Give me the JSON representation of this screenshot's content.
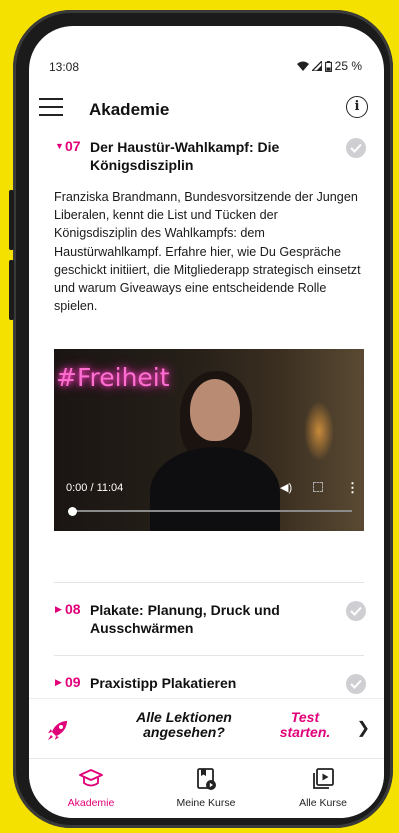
{
  "status": {
    "time": "13:08",
    "battery": "25 %"
  },
  "appbar": {
    "title": "Akademie",
    "menu_icon": "menu-icon",
    "info_icon": "info-icon"
  },
  "lessons": [
    {
      "number": "07",
      "title": "Der Haustür-Wahlkampf: Die Königsdisziplin",
      "expanded": true,
      "completed": true,
      "description": "Franziska Brandmann, Bundesvorsitzende der Jungen Liberalen, kennt die List und Tücken der Königsdisziplin des Wahlkampfs: dem Haustürwahlkampf. Erfahre hier, wie Du Gespräche geschickt initiiert, die Mitgliederapp strategisch einsetzt und warum Giveaways eine entscheidende Rolle spielen."
    },
    {
      "number": "08",
      "title": "Plakate: Planung, Druck und Ausschwärmen",
      "expanded": false,
      "completed": true
    },
    {
      "number": "09",
      "title": "Praxistipp Plakatieren",
      "expanded": false,
      "completed": true
    }
  ],
  "video": {
    "overlay_text": "#Freiheit",
    "time": "0:00 / 11:04",
    "progress": 0
  },
  "cta": {
    "question": "Alle Lektionen angesehen?",
    "action": "Test starten."
  },
  "nav": [
    {
      "label": "Akademie",
      "icon": "graduation-cap-icon",
      "active": true
    },
    {
      "label": "Meine Kurse",
      "icon": "bookmark-play-icon",
      "active": false
    },
    {
      "label": "Alle Kurse",
      "icon": "play-library-icon",
      "active": false
    }
  ],
  "colors": {
    "accent": "#e0007a",
    "background": "#f5e100",
    "check": "#cfcfd3"
  }
}
